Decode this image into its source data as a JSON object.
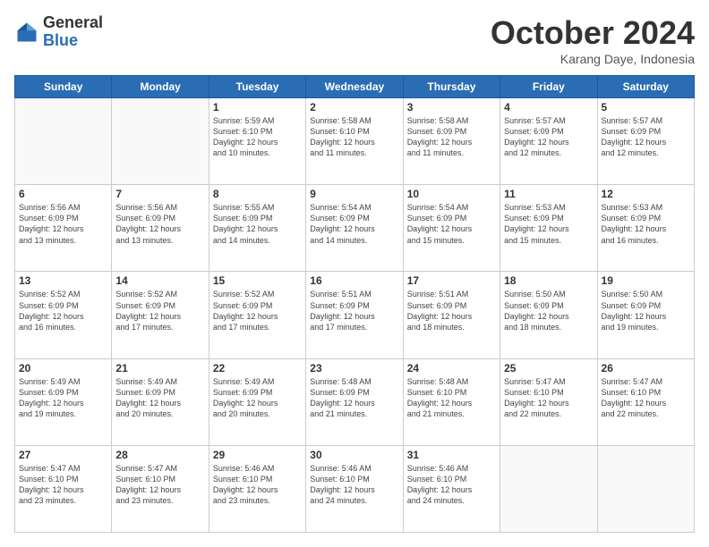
{
  "header": {
    "logo_general": "General",
    "logo_blue": "Blue",
    "month": "October 2024",
    "location": "Karang Daye, Indonesia"
  },
  "weekdays": [
    "Sunday",
    "Monday",
    "Tuesday",
    "Wednesday",
    "Thursday",
    "Friday",
    "Saturday"
  ],
  "weeks": [
    [
      {
        "day": "",
        "info": ""
      },
      {
        "day": "",
        "info": ""
      },
      {
        "day": "1",
        "info": "Sunrise: 5:59 AM\nSunset: 6:10 PM\nDaylight: 12 hours\nand 10 minutes."
      },
      {
        "day": "2",
        "info": "Sunrise: 5:58 AM\nSunset: 6:10 PM\nDaylight: 12 hours\nand 11 minutes."
      },
      {
        "day": "3",
        "info": "Sunrise: 5:58 AM\nSunset: 6:09 PM\nDaylight: 12 hours\nand 11 minutes."
      },
      {
        "day": "4",
        "info": "Sunrise: 5:57 AM\nSunset: 6:09 PM\nDaylight: 12 hours\nand 12 minutes."
      },
      {
        "day": "5",
        "info": "Sunrise: 5:57 AM\nSunset: 6:09 PM\nDaylight: 12 hours\nand 12 minutes."
      }
    ],
    [
      {
        "day": "6",
        "info": "Sunrise: 5:56 AM\nSunset: 6:09 PM\nDaylight: 12 hours\nand 13 minutes."
      },
      {
        "day": "7",
        "info": "Sunrise: 5:56 AM\nSunset: 6:09 PM\nDaylight: 12 hours\nand 13 minutes."
      },
      {
        "day": "8",
        "info": "Sunrise: 5:55 AM\nSunset: 6:09 PM\nDaylight: 12 hours\nand 14 minutes."
      },
      {
        "day": "9",
        "info": "Sunrise: 5:54 AM\nSunset: 6:09 PM\nDaylight: 12 hours\nand 14 minutes."
      },
      {
        "day": "10",
        "info": "Sunrise: 5:54 AM\nSunset: 6:09 PM\nDaylight: 12 hours\nand 15 minutes."
      },
      {
        "day": "11",
        "info": "Sunrise: 5:53 AM\nSunset: 6:09 PM\nDaylight: 12 hours\nand 15 minutes."
      },
      {
        "day": "12",
        "info": "Sunrise: 5:53 AM\nSunset: 6:09 PM\nDaylight: 12 hours\nand 16 minutes."
      }
    ],
    [
      {
        "day": "13",
        "info": "Sunrise: 5:52 AM\nSunset: 6:09 PM\nDaylight: 12 hours\nand 16 minutes."
      },
      {
        "day": "14",
        "info": "Sunrise: 5:52 AM\nSunset: 6:09 PM\nDaylight: 12 hours\nand 17 minutes."
      },
      {
        "day": "15",
        "info": "Sunrise: 5:52 AM\nSunset: 6:09 PM\nDaylight: 12 hours\nand 17 minutes."
      },
      {
        "day": "16",
        "info": "Sunrise: 5:51 AM\nSunset: 6:09 PM\nDaylight: 12 hours\nand 17 minutes."
      },
      {
        "day": "17",
        "info": "Sunrise: 5:51 AM\nSunset: 6:09 PM\nDaylight: 12 hours\nand 18 minutes."
      },
      {
        "day": "18",
        "info": "Sunrise: 5:50 AM\nSunset: 6:09 PM\nDaylight: 12 hours\nand 18 minutes."
      },
      {
        "day": "19",
        "info": "Sunrise: 5:50 AM\nSunset: 6:09 PM\nDaylight: 12 hours\nand 19 minutes."
      }
    ],
    [
      {
        "day": "20",
        "info": "Sunrise: 5:49 AM\nSunset: 6:09 PM\nDaylight: 12 hours\nand 19 minutes."
      },
      {
        "day": "21",
        "info": "Sunrise: 5:49 AM\nSunset: 6:09 PM\nDaylight: 12 hours\nand 20 minutes."
      },
      {
        "day": "22",
        "info": "Sunrise: 5:49 AM\nSunset: 6:09 PM\nDaylight: 12 hours\nand 20 minutes."
      },
      {
        "day": "23",
        "info": "Sunrise: 5:48 AM\nSunset: 6:09 PM\nDaylight: 12 hours\nand 21 minutes."
      },
      {
        "day": "24",
        "info": "Sunrise: 5:48 AM\nSunset: 6:10 PM\nDaylight: 12 hours\nand 21 minutes."
      },
      {
        "day": "25",
        "info": "Sunrise: 5:47 AM\nSunset: 6:10 PM\nDaylight: 12 hours\nand 22 minutes."
      },
      {
        "day": "26",
        "info": "Sunrise: 5:47 AM\nSunset: 6:10 PM\nDaylight: 12 hours\nand 22 minutes."
      }
    ],
    [
      {
        "day": "27",
        "info": "Sunrise: 5:47 AM\nSunset: 6:10 PM\nDaylight: 12 hours\nand 23 minutes."
      },
      {
        "day": "28",
        "info": "Sunrise: 5:47 AM\nSunset: 6:10 PM\nDaylight: 12 hours\nand 23 minutes."
      },
      {
        "day": "29",
        "info": "Sunrise: 5:46 AM\nSunset: 6:10 PM\nDaylight: 12 hours\nand 23 minutes."
      },
      {
        "day": "30",
        "info": "Sunrise: 5:46 AM\nSunset: 6:10 PM\nDaylight: 12 hours\nand 24 minutes."
      },
      {
        "day": "31",
        "info": "Sunrise: 5:46 AM\nSunset: 6:10 PM\nDaylight: 12 hours\nand 24 minutes."
      },
      {
        "day": "",
        "info": ""
      },
      {
        "day": "",
        "info": ""
      }
    ]
  ]
}
